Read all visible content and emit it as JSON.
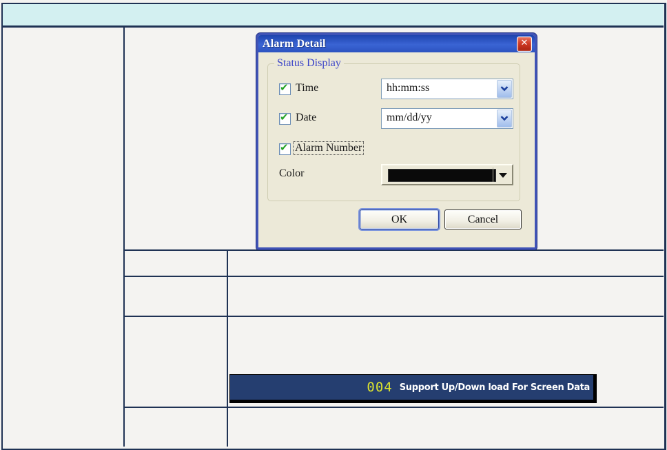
{
  "page": {
    "background_color": "#f4f3f1",
    "grid_border_color": "#1f3254",
    "banner_fill_color": "#d3f0f1"
  },
  "dialog": {
    "title": "Alarm Detail",
    "group_label": "Status Display",
    "checkboxes": [
      {
        "label": "Time",
        "checked": true,
        "combo_value": "hh:mm:ss"
      },
      {
        "label": "Date",
        "checked": true,
        "combo_value": "mm/dd/yy"
      },
      {
        "label": "Alarm Number",
        "checked": true
      }
    ],
    "color_label": "Color",
    "color_value": "#0a0a0a",
    "buttons": {
      "ok": "OK",
      "cancel": "Cancel"
    }
  },
  "alarm_bar": {
    "number": "004",
    "message": "Support Up/Down load For Screen Data",
    "number_color": "#dce32e",
    "background_color": "#253e70"
  }
}
